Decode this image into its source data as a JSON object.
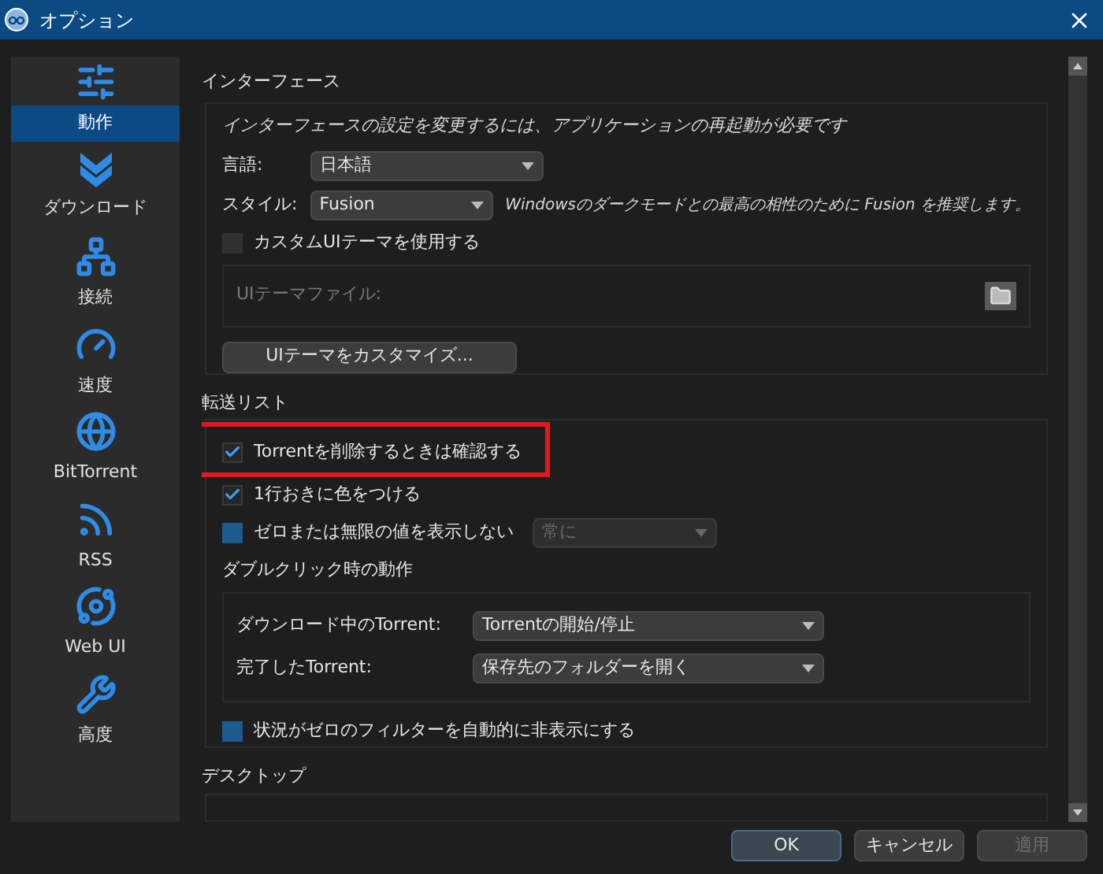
{
  "window": {
    "title": "オプション"
  },
  "sidebar": {
    "items": [
      {
        "label": "動作",
        "selected": true
      },
      {
        "label": "ダウンロード",
        "selected": false
      },
      {
        "label": "接続",
        "selected": false
      },
      {
        "label": "速度",
        "selected": false
      },
      {
        "label": "BitTorrent",
        "selected": false
      },
      {
        "label": "RSS",
        "selected": false
      },
      {
        "label": "Web UI",
        "selected": false
      },
      {
        "label": "高度",
        "selected": false
      }
    ]
  },
  "interface": {
    "heading": "インターフェース",
    "note": "インターフェースの設定を変更するには、アプリケーションの再起動が必要です",
    "language": {
      "label": "言語:",
      "value": "日本語"
    },
    "style": {
      "label": "スタイル:",
      "value": "Fusion",
      "note": "Windowsのダークモードとの最高の相性のために Fusion を推奨します。"
    },
    "custom_theme": {
      "label": "カスタムUIテーマを使用する",
      "checked": false,
      "accent": false
    },
    "theme_file": {
      "label": "UIテーマファイル:",
      "disabled": true
    },
    "customize_button": "UIテーマをカスタマイズ..."
  },
  "transfer_list": {
    "heading": "転送リスト",
    "confirm_delete": {
      "label": "Torrentを削除するときは確認する",
      "checked": true
    },
    "alternate_colors": {
      "label": "1行おきに色をつける",
      "checked": true
    },
    "hide_zero": {
      "label": "ゼロまたは無限の値を表示しない",
      "checked": false,
      "accent": true,
      "combo": {
        "value": "常に",
        "disabled": true
      }
    },
    "double_click": {
      "heading": "ダブルクリック時の動作",
      "rows": [
        {
          "label": "ダウンロード中のTorrent:",
          "value": "Torrentの開始/停止"
        },
        {
          "label": "完了したTorrent:",
          "value": "保存先のフォルダーを開く"
        }
      ]
    },
    "hide_zero_filters": {
      "label": "状況がゼロのフィルターを自動的に非表示にする",
      "checked": false,
      "accent": true
    }
  },
  "desktop": {
    "heading": "デスクトップ"
  },
  "buttons": [
    {
      "label": "OK",
      "default": true,
      "disabled": false
    },
    {
      "label": "キャンセル",
      "default": false,
      "disabled": false
    },
    {
      "label": "適用",
      "default": false,
      "disabled": true
    }
  ]
}
